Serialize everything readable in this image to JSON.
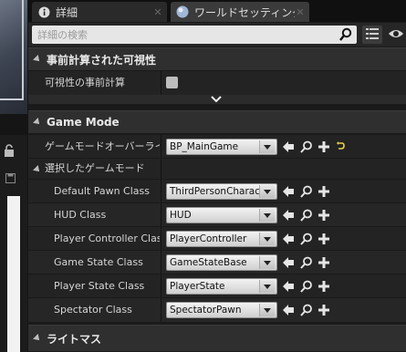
{
  "tabs": [
    {
      "label": "詳細",
      "icon": "info-icon"
    },
    {
      "label": "ワールドセッティング",
      "icon": "globe-icon"
    }
  ],
  "search": {
    "placeholder": "詳細の検索"
  },
  "sections": {
    "precompute": {
      "title": "事前計算された可視性",
      "rows": [
        {
          "label": "可視性の事前計算",
          "checked": false
        }
      ]
    },
    "game_mode": {
      "title": "Game Mode",
      "override_label": "ゲームモードオーバーライド",
      "override_value": "BP_MainGame",
      "selected_group": "選択したゲームモード",
      "rows": [
        {
          "label": "Default Pawn Class",
          "value": "ThirdPersonCharacter"
        },
        {
          "label": "HUD Class",
          "value": "HUD"
        },
        {
          "label": "Player Controller Class",
          "value": "PlayerController"
        },
        {
          "label": "Game State Class",
          "value": "GameStateBase"
        },
        {
          "label": "Player State Class",
          "value": "PlayerState"
        },
        {
          "label": "Spectator Class",
          "value": "SpectatorPawn"
        }
      ]
    },
    "lightmass": {
      "title": "ライトマス"
    }
  },
  "colors": {
    "accent_reset": "#e8d24a",
    "panel": "#232323",
    "category": "#2f2f2f"
  }
}
